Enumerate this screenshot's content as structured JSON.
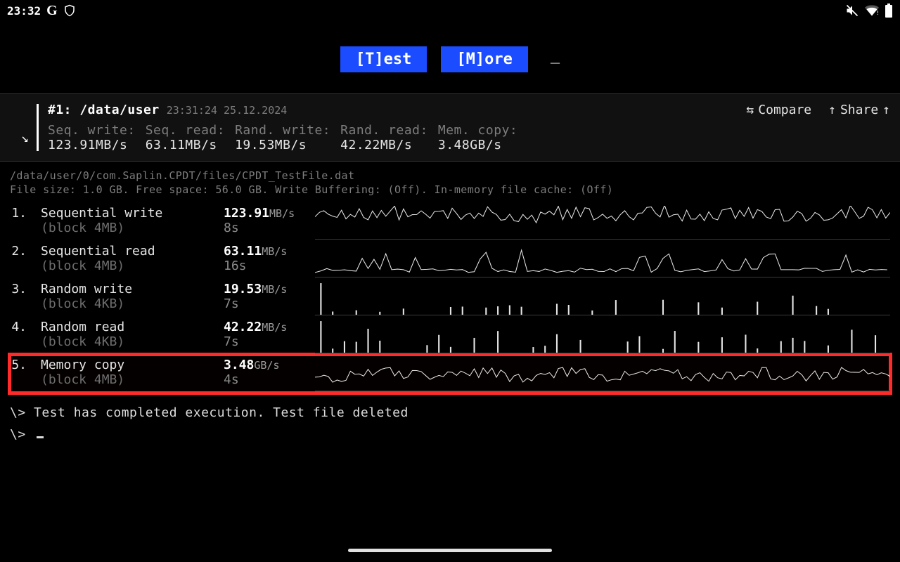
{
  "statusbar": {
    "time": "23:32"
  },
  "buttons": {
    "test_pre": "[T]",
    "test_post": "est",
    "more_pre": "[M]",
    "more_post": "ore"
  },
  "summary": {
    "title": "#1: /data/user",
    "timestamp": "23:31:24 25.12.2024",
    "compare": "Compare",
    "share": "Share",
    "metrics": [
      {
        "label": "Seq. write:",
        "value": "123.91MB/s"
      },
      {
        "label": "Seq. read:",
        "value": "63.11MB/s"
      },
      {
        "label": "Rand. write:",
        "value": "19.53MB/s"
      },
      {
        "label": "Rand. read:",
        "value": "42.22MB/s"
      },
      {
        "label": "Mem. copy:",
        "value": "3.48GB/s"
      }
    ]
  },
  "fileinfo": {
    "path": "/data/user/0/com.Saplin.CPDT/files/CPDT_TestFile.dat",
    "details": "File size: 1.0 GB. Free space: 56.0 GB. Write Buffering: (Off). In-memory file cache: (Off)"
  },
  "rows": [
    {
      "n": "1.",
      "name": "Sequential write",
      "sub": "(block 4MB)",
      "val": "123.91",
      "unit": "MB/s",
      "dur": "8s",
      "kind": "noisy-high"
    },
    {
      "n": "2.",
      "name": "Sequential read",
      "sub": "(block 4MB)",
      "val": "63.11",
      "unit": "MB/s",
      "dur": "16s",
      "kind": "bumpy"
    },
    {
      "n": "3.",
      "name": "Random write",
      "sub": "(block 4KB)",
      "val": "19.53",
      "unit": "MB/s",
      "dur": "7s",
      "kind": "sparse"
    },
    {
      "n": "4.",
      "name": "Random read",
      "sub": "(block 4KB)",
      "val": "42.22",
      "unit": "MB/s",
      "dur": "7s",
      "kind": "sparse2"
    },
    {
      "n": "5.",
      "name": "Memory copy",
      "sub": "(block 4MB)",
      "val": "3.48",
      "unit": "GB/s",
      "dur": "4s",
      "kind": "noisy-mid",
      "hl": true
    }
  ],
  "terminal": {
    "line1": "\\> Test has completed execution. Test file deleted",
    "line2": "\\> "
  }
}
